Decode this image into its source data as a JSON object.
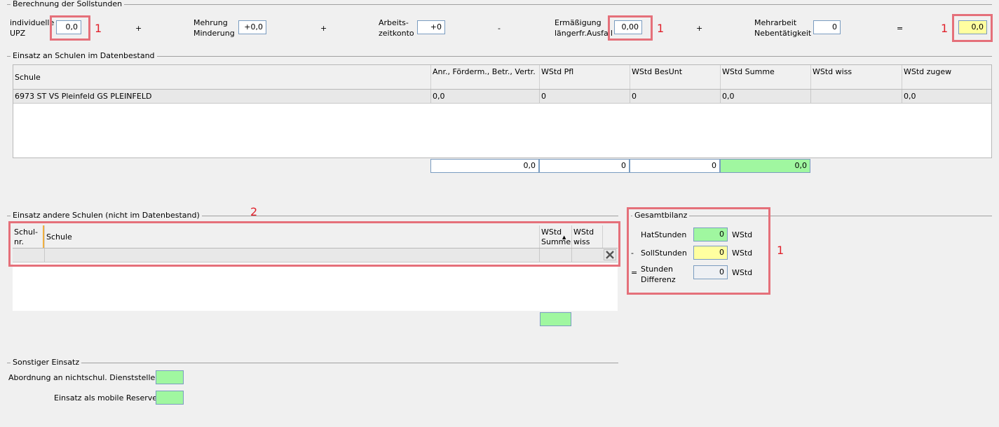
{
  "sollstunden": {
    "title": "Berechnung der Sollstunden",
    "upz_label": "individuelle UPZ",
    "upz_value": "0,0",
    "op_plus1": "+",
    "mehrung_label": "Mehrung Minderung",
    "mehrung_value": "+0,0",
    "op_plus2": "+",
    "arbeitszeit_label": "Arbeits- zeitkonto",
    "arbeitszeit_value": "+0",
    "op_minus": "-",
    "ermaessigung_label": "Ermäßigung längerfr.Ausfall",
    "ermaessigung_value": "0,00",
    "op_plus3": "+",
    "mehrarbeit_label": "Mehrarbeit Nebentätigkeit",
    "mehrarbeit_value": "0",
    "op_equals": "=",
    "result_value": "0,0"
  },
  "einsatz_schulen": {
    "title": "Einsatz an Schulen im Datenbestand",
    "columns": [
      "Schule",
      "Anr., Förderm., Betr., Vertr.",
      "WStd Pfl",
      "WStd BesUnt",
      "WStd Summe",
      "WStd wiss",
      "WStd zugew"
    ],
    "rows": [
      [
        "6973 ST VS Pleinfeld GS PLEINFELD",
        "0,0",
        "0",
        "0",
        "0,0",
        "",
        "0,0"
      ]
    ],
    "totals": [
      "0,0",
      "0",
      "0",
      "0,0"
    ]
  },
  "andere_schulen": {
    "title": "Einsatz andere Schulen (nicht im Datenbestand)",
    "columns": [
      "Schul- nr.",
      "Schule",
      "WStd Summe",
      "WStd wiss"
    ]
  },
  "gesamtbilanz": {
    "title": "Gesamtbilanz",
    "hat_label": "HatStunden",
    "hat_value": "0",
    "hat_unit": "WStd",
    "minus": "-",
    "soll_label": "SollStunden",
    "soll_value": "0",
    "soll_unit": "WStd",
    "equals": "=",
    "diff_label": "Stunden Differenz",
    "diff_value": "0",
    "diff_unit": "WStd"
  },
  "sonstiger": {
    "title": "Sonstiger Einsatz",
    "abordnung_label": "Abordnung an nichtschul. Dienststelle",
    "reserve_label": "Einsatz als mobile Reserve"
  },
  "annotations": {
    "mark1": "1",
    "mark2": "2",
    "color": "#e0212b"
  }
}
